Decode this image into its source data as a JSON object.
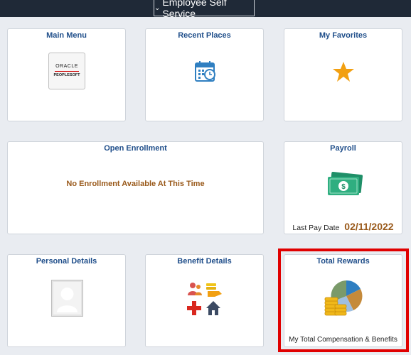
{
  "header": {
    "title": "Employee Self Service"
  },
  "tiles": {
    "main_menu": {
      "title": "Main Menu",
      "logo_line1": "ORACLE",
      "logo_line2": "PEOPLESOFT"
    },
    "recent_places": {
      "title": "Recent Places"
    },
    "my_favorites": {
      "title": "My Favorites"
    },
    "open_enrollment": {
      "title": "Open Enrollment",
      "message": "No Enrollment Available At This Time"
    },
    "payroll": {
      "title": "Payroll",
      "last_pay_label": "Last Pay Date",
      "last_pay_date": "02/11/2022"
    },
    "personal_details": {
      "title": "Personal Details"
    },
    "benefit_details": {
      "title": "Benefit Details"
    },
    "total_rewards": {
      "title": "Total Rewards",
      "subtitle": "My Total Compensation & Benefits"
    }
  },
  "colors": {
    "header_bg": "#1f2937",
    "tile_title": "#1f4e8a",
    "accent_brown": "#99591a",
    "highlight": "#e00000"
  }
}
